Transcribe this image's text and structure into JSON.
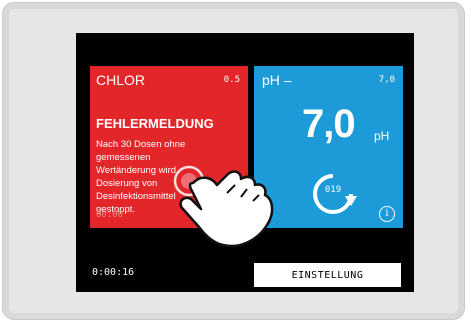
{
  "red_panel": {
    "title": "CHLOR",
    "corner_value": "0.5",
    "error_heading": "FEHLERMELDUNG",
    "error_lines": [
      "Nach 30 Dosen ohne",
      "gemessenen",
      "Wertänderung wird",
      "Dosierung von",
      "Desinfektionsmittel",
      "gestoppt."
    ],
    "faded_time": "00:00"
  },
  "blue_panel": {
    "title": "pH –",
    "corner_value": "7,0",
    "value": "7,0",
    "unit": "pH",
    "cycle_count": "019"
  },
  "footer": {
    "timer": "0:00:16",
    "setting_button_label": "EINSTELLUNG"
  },
  "colors": {
    "error_red": "#e3262a",
    "ph_blue": "#1d9bd8",
    "screen_bg": "#000000"
  },
  "icons": [
    "info-icon",
    "refresh-cycle-icon",
    "pointing-hand-icon"
  ]
}
